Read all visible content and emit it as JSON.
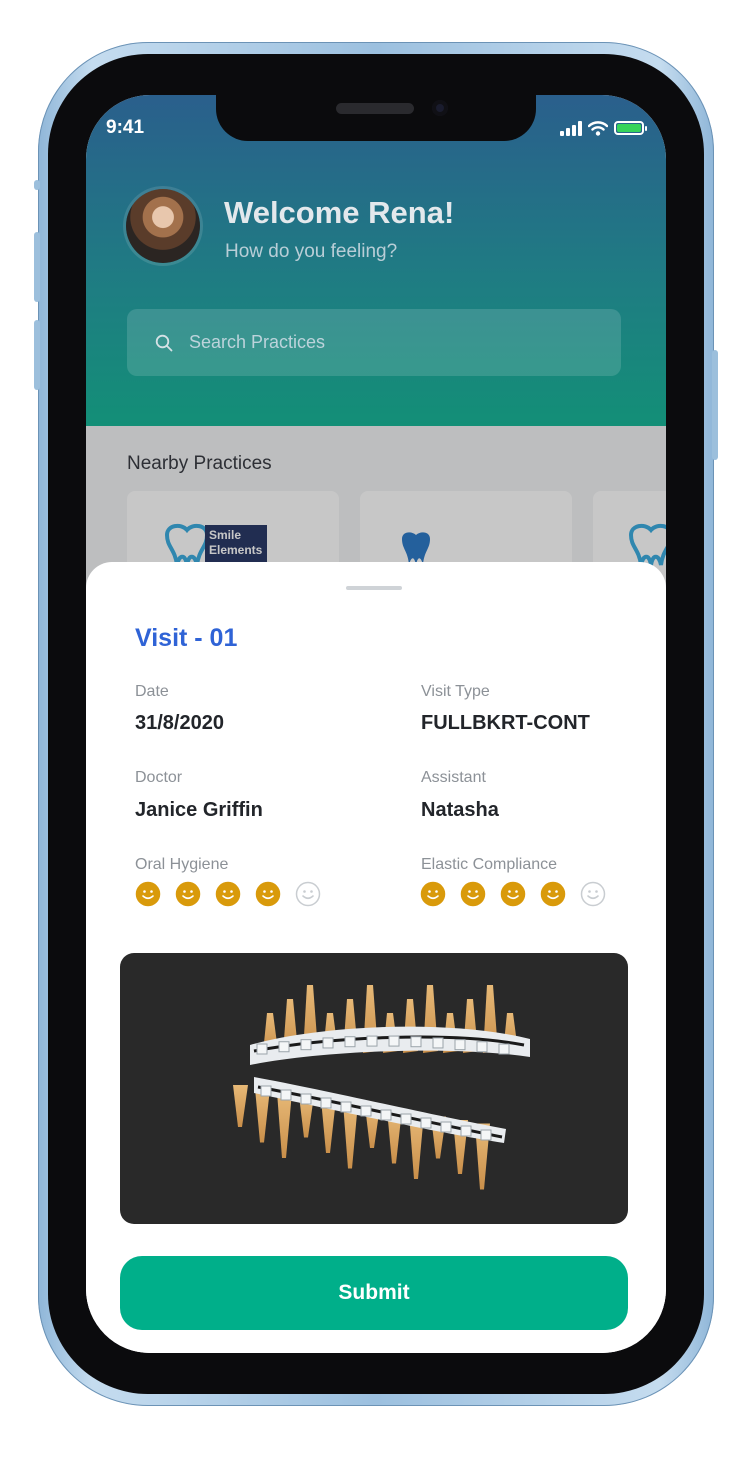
{
  "status_bar": {
    "time": "9:41"
  },
  "header": {
    "welcome": "Welcome Rena!",
    "subtitle": "How do you feeling?"
  },
  "search": {
    "placeholder": "Search Practices",
    "value": ""
  },
  "nearby": {
    "title": "Nearby Practices",
    "practices": [
      {
        "logo_text_1": "Smile",
        "logo_text_2": "Elements",
        "logo": "tooth-logo"
      },
      {
        "logo": "tooth-icon"
      },
      {
        "logo": "tooth-logo"
      }
    ]
  },
  "visit": {
    "title": "Visit - 01",
    "date_label": "Date",
    "date_value": "31/8/2020",
    "visit_type_label": "Visit Type",
    "visit_type_value": "FULLBKRT-CONT",
    "doctor_label": "Doctor",
    "doctor_value": "Janice Griffin",
    "assistant_label": "Assistant",
    "assistant_value": "Natasha",
    "oral_hygiene_label": "Oral Hygiene",
    "oral_hygiene_rating": 4,
    "elastic_compliance_label": "Elastic Compliance",
    "elastic_compliance_rating": 4,
    "rating_max": 5,
    "image": "3d-teeth-braces"
  },
  "submit_label": "Submit",
  "colors": {
    "header_top": "#2a5f8c",
    "header_bottom": "#138f77",
    "accent_blue": "#2f63d6",
    "submit_green": "#00af8a",
    "smiley_active": "#d99a0b",
    "smiley_inactive": "#c9cdd1"
  }
}
